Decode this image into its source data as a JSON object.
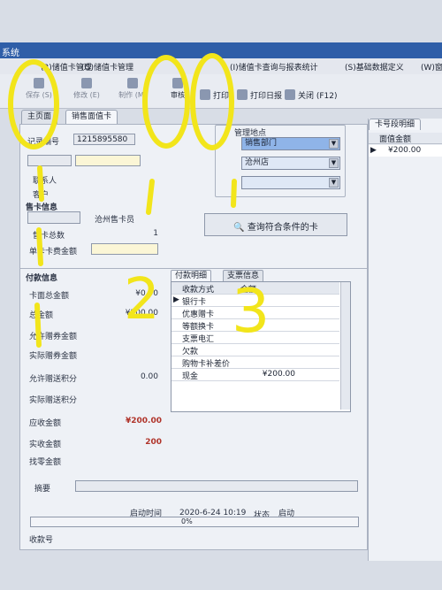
{
  "window": {
    "title": "系统"
  },
  "menu": [
    "(3)储值卡管理",
    "(G)储值卡管理",
    "(I)储值卡查询与报表统计",
    "(S)基础数据定义",
    "(W)窗口"
  ],
  "toolbar": {
    "save": "保存 (S)",
    "edit": "修改 (E)",
    "make": "制作 (M)",
    "audit": "审核",
    "print": "打印",
    "print_daily": "打印日报",
    "close": "关闭 (F12)"
  },
  "tabs": {
    "home": "主页面",
    "sell_card": "销售面值卡"
  },
  "form": {
    "record_no_label": "记录编号",
    "record_no": "1215895580",
    "contact_label": "联系人",
    "customer_label": "客户",
    "sell_section": "售卡信息",
    "store_label": "沧州售卡员",
    "card_count_label": "售卡总数",
    "card_count": "1",
    "card_amount_label": "单卡卡费金额",
    "mgmt_location_label": "管理地点",
    "dept": "销售部门",
    "store": "沧州店",
    "query_btn": "查询符合条件的卡",
    "pay_section": "付款信息",
    "card_face_label": "卡面总金额",
    "card_face_value": "¥0.00",
    "total_label": "总金额",
    "total_value": "¥200.00",
    "allow_coupon_label": "允许赠券金额",
    "actual_coupon_label": "实际赠券金额",
    "allow_points_label": "允许赠送积分",
    "allow_points_value": "0.00",
    "actual_points_label": "实际赠送积分",
    "receivable_label": "应收金额",
    "receivable_value": "¥200.00",
    "received_label": "实收金额",
    "received_value": "200",
    "change_label": "找零金额",
    "summary_label": "摘要",
    "start_time_label": "启动时间",
    "start_time": "2020-6-24 10:19",
    "status_label": "状态",
    "status_value": "启动",
    "progress_text": "0%",
    "progress": 0,
    "receipt_label": "收款号"
  },
  "pay_tabs": {
    "detail": "付款明细",
    "check": "支票信息"
  },
  "pay_grid": {
    "headers": [
      "收款方式",
      "金额"
    ],
    "rows": [
      {
        "method": "银行卡",
        "amount": ""
      },
      {
        "method": "优惠赠卡",
        "amount": ""
      },
      {
        "method": "等额换卡",
        "amount": ""
      },
      {
        "method": "支票电汇",
        "amount": ""
      },
      {
        "method": "欠款",
        "amount": ""
      },
      {
        "method": "购物卡补差价",
        "amount": ""
      },
      {
        "method": "现金",
        "amount": "¥200.00"
      }
    ]
  },
  "right": {
    "tab": "卡号段明细",
    "header": "面值金额",
    "row": "¥200.00"
  },
  "annotations": {
    "n1": "1",
    "n2": "2",
    "n3": "3"
  },
  "colors": {
    "title": "#2f5ea8",
    "highlight": "#8fb4e8",
    "scribble": "#f2e51b"
  }
}
